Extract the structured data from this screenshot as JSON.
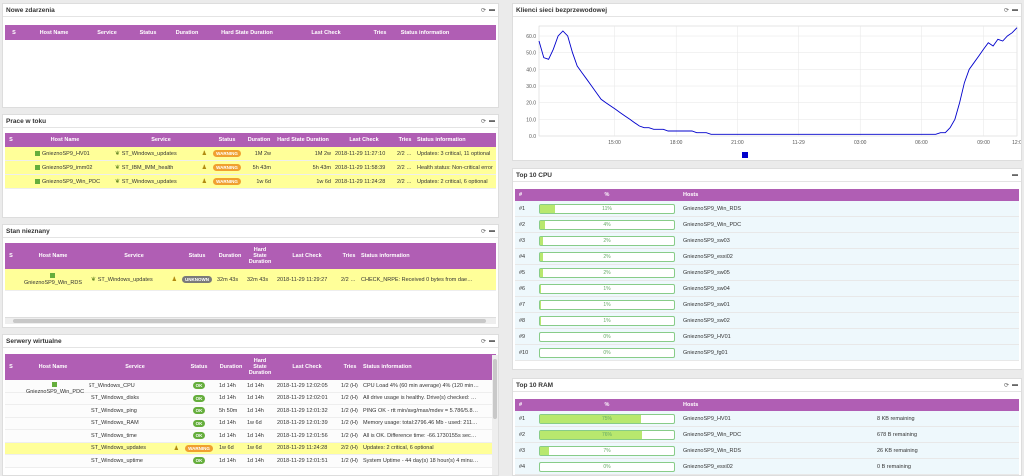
{
  "panels": {
    "nowe": {
      "title": "Nowe zdarzenia",
      "headers": [
        "S",
        "Host Name",
        "Service",
        "Status",
        "Duration",
        "Hard State Duration",
        "Last Check",
        "Tries",
        "Status information"
      ]
    },
    "prace": {
      "title": "Prace w toku",
      "headers": [
        "S",
        "Host Name",
        "Service",
        "Status",
        "Duration",
        "Hard State Duration",
        "Last Check",
        "Tries",
        "Status information"
      ],
      "rows": [
        {
          "host": "GnieznoSP9_HV01",
          "service": "ST_Windows_updates",
          "status": "WARNING",
          "duration": "1M 2w",
          "hard": "1M 2w",
          "check": "2018-11-29 11:27:10",
          "tries": "2/2 (H)",
          "info": "Updates: 3 critical, 11 optional"
        },
        {
          "host": "GnieznoSP9_imm02",
          "service": "ST_IBM_IMM_health",
          "status": "WARNING",
          "duration": "5h 43m",
          "hard": "5h 43m",
          "check": "2018-11-29 11:58:39",
          "tries": "2/2 (H)",
          "info": "Health status: Non-critical error"
        },
        {
          "host": "GnieznoSP9_Win_PDC",
          "service": "ST_Windows_updates",
          "status": "WARNING",
          "duration": "1w 6d",
          "hard": "1w 6d",
          "check": "2018-11-29 11:24:28",
          "tries": "2/2 (H)",
          "info": "Updates: 2 critical, 6 optional"
        }
      ]
    },
    "stan": {
      "title": "Stan nieznany",
      "headers": [
        "S",
        "Host Name",
        "Service",
        "Status",
        "Duration",
        "Hard State Duration",
        "Last Check",
        "Tries",
        "Status information"
      ],
      "rows": [
        {
          "host": "GnieznoSP9_Win_RDS",
          "service": "ST_Windows_updates",
          "status": "UNKNOWN",
          "duration": "32m 43s",
          "hard": "32m 43s",
          "check": "2018-11-29 11:29:27",
          "tries": "2/2 (H)",
          "info": "CHECK_NRPE: Received 0 bytes from daemon. Chec"
        }
      ]
    },
    "serwery": {
      "title": "Serwery wirtualne",
      "headers": [
        "S",
        "Host Name",
        "Service",
        "Status",
        "Duration",
        "Hard State Duration",
        "Last Check",
        "Tries",
        "Status information"
      ],
      "host": "GnieznoSP9_Win_PDC",
      "rows": [
        {
          "service": "ST_Windows_CPU",
          "status": "OK",
          "duration": "1d 14h",
          "hard": "1d 14h",
          "check": "2018-11-29 12:02:05",
          "tries": "1/2 (H)",
          "info": "CPU Load 4% (60 min average) 4% (120 min aver"
        },
        {
          "service": "ST_Windows_disks",
          "status": "OK",
          "duration": "1d 14h",
          "hard": "1d 14h",
          "check": "2018-11-29 12:02:01",
          "tries": "1/2 (H)",
          "info": "All drive usage is healthy. Drive(s) checked: D: ("
        },
        {
          "service": "ST_Windows_ping",
          "status": "OK",
          "duration": "5h 50m",
          "hard": "1d 14h",
          "check": "2018-11-29 12:01:32",
          "tries": "1/2 (H)",
          "info": "PING OK - rtt min/avg/max/mdev = 5.786/5.855/5.!"
        },
        {
          "service": "ST_Windows_RAM",
          "status": "OK",
          "duration": "1d 14h",
          "hard": "1w 6d",
          "check": "2018-11-29 12:01:39",
          "tries": "1/2 (H)",
          "info": "Memory usage: total:2796.46 Mb - used: 2119.78 I"
        },
        {
          "service": "ST_Windows_time",
          "status": "OK",
          "duration": "1d 14h",
          "hard": "1d 14h",
          "check": "2018-11-29 12:01:56",
          "tries": "1/2 (H)",
          "info": "All is OK. Difference time: -66.1730155s seconds /"
        },
        {
          "service": "ST_Windows_updates",
          "status": "WARNING",
          "duration": "1w 6d",
          "hard": "1w 6d",
          "check": "2018-11-29 11:24:28",
          "tries": "2/2 (H)",
          "info": "Updates: 2 critical, 6 optional"
        },
        {
          "service": "ST_Windows_uptime",
          "status": "OK",
          "duration": "1d 14h",
          "hard": "1d 14h",
          "check": "2018-11-29 12:01:51",
          "tries": "1/2 (H)",
          "info": "System Uptime - 44 day(s) 18 hour(s) 4 minute(s)"
        }
      ]
    },
    "klienci": {
      "title": "Klienci sieci bezprzewodowej"
    },
    "cpu": {
      "title": "Top 10 CPU",
      "headers": [
        "#",
        "%",
        "Hosts"
      ],
      "rows": [
        {
          "rank": "#1",
          "pct": 11,
          "label": "11%",
          "host": "GnieznoSP9_Win_RDS"
        },
        {
          "rank": "#2",
          "pct": 4,
          "label": "4%",
          "host": "GnieznoSP9_Win_PDC"
        },
        {
          "rank": "#3",
          "pct": 2,
          "label": "2%",
          "host": "GnieznoSP9_sw03"
        },
        {
          "rank": "#4",
          "pct": 2,
          "label": "2%",
          "host": "GnieznoSP9_esxi02"
        },
        {
          "rank": "#5",
          "pct": 2,
          "label": "2%",
          "host": "GnieznoSP9_sw05"
        },
        {
          "rank": "#6",
          "pct": 1,
          "label": "1%",
          "host": "GnieznoSP9_sw04"
        },
        {
          "rank": "#7",
          "pct": 1,
          "label": "1%",
          "host": "GnieznoSP9_sw01"
        },
        {
          "rank": "#8",
          "pct": 1,
          "label": "1%",
          "host": "GnieznoSP9_sw02"
        },
        {
          "rank": "#9",
          "pct": 0,
          "label": "0%",
          "host": "GnieznoSP9_HV01"
        },
        {
          "rank": "#10",
          "pct": 0,
          "label": "0%",
          "host": "GnieznoSP9_fg01"
        }
      ]
    },
    "ram": {
      "title": "Top 10 RAM",
      "headers": [
        "#",
        "%",
        "Hosts"
      ],
      "rows": [
        {
          "rank": "#1",
          "pct": 75,
          "label": "75%",
          "host": "GnieznoSP9_HV01",
          "extra": "8 KB remaining"
        },
        {
          "rank": "#2",
          "pct": 76,
          "label": "76%",
          "host": "GnieznoSP9_Win_PDC",
          "extra": "678 B remaining"
        },
        {
          "rank": "#3",
          "pct": 7,
          "label": "7%",
          "host": "GnieznoSP9_Win_RDS",
          "extra": "26 KB remaining"
        },
        {
          "rank": "#4",
          "pct": 0,
          "label": "0%",
          "host": "GnieznoSP9_esxi02",
          "extra": "0 B remaining"
        }
      ]
    }
  },
  "chart_data": {
    "type": "line",
    "y_ticks": [
      "60.0",
      "50.0",
      "40.0",
      "30.0",
      "20.0",
      "10.0",
      "0.0"
    ],
    "x_ticks": [
      "15:00",
      "18:00",
      "21:00",
      "11-29",
      "03:00",
      "06:00",
      "09:00",
      "12:0"
    ],
    "ylim": [
      0,
      66
    ],
    "color": "#0000cc",
    "x": [
      0,
      1,
      2,
      3,
      4,
      5,
      6,
      7,
      8,
      9,
      10,
      11,
      12,
      13,
      14,
      15,
      16,
      17,
      18,
      19,
      20,
      21,
      22,
      23,
      24,
      25,
      26,
      27,
      28,
      29,
      30,
      31,
      32,
      33,
      34,
      35,
      36,
      37,
      38,
      39,
      40,
      41,
      42,
      43,
      44,
      45,
      46,
      47,
      48,
      49,
      50,
      51,
      52,
      53,
      54,
      55,
      56,
      57,
      58,
      59,
      60,
      61,
      62,
      63,
      64,
      65,
      66,
      67,
      68,
      69,
      70,
      71,
      72,
      73,
      74,
      75,
      76,
      77,
      78,
      79,
      80,
      81,
      82,
      83,
      84,
      85,
      86,
      87,
      88,
      89,
      90,
      91,
      92,
      93,
      94,
      95,
      96,
      97,
      98,
      99,
      100
    ],
    "values": [
      57,
      47,
      46,
      52,
      60,
      63,
      60,
      50,
      42,
      38,
      34,
      30,
      26,
      22,
      20,
      18,
      16,
      14,
      12,
      10,
      8,
      6,
      5,
      5,
      4,
      4,
      4,
      3,
      3,
      3,
      3,
      3,
      3,
      2,
      2,
      2,
      1,
      1,
      1,
      1,
      1,
      1,
      1,
      1,
      1,
      1,
      1,
      1,
      1,
      1,
      1,
      1,
      1,
      1,
      1,
      1,
      1,
      1,
      1,
      1,
      1,
      1,
      1,
      1,
      1,
      1,
      1,
      1,
      1,
      1,
      1,
      1,
      1,
      1,
      1,
      1,
      1,
      1,
      1,
      1,
      1,
      1,
      1,
      1,
      2,
      2,
      5,
      10,
      20,
      32,
      40,
      44,
      48,
      52,
      56,
      54,
      58,
      57,
      60,
      62,
      65
    ]
  }
}
